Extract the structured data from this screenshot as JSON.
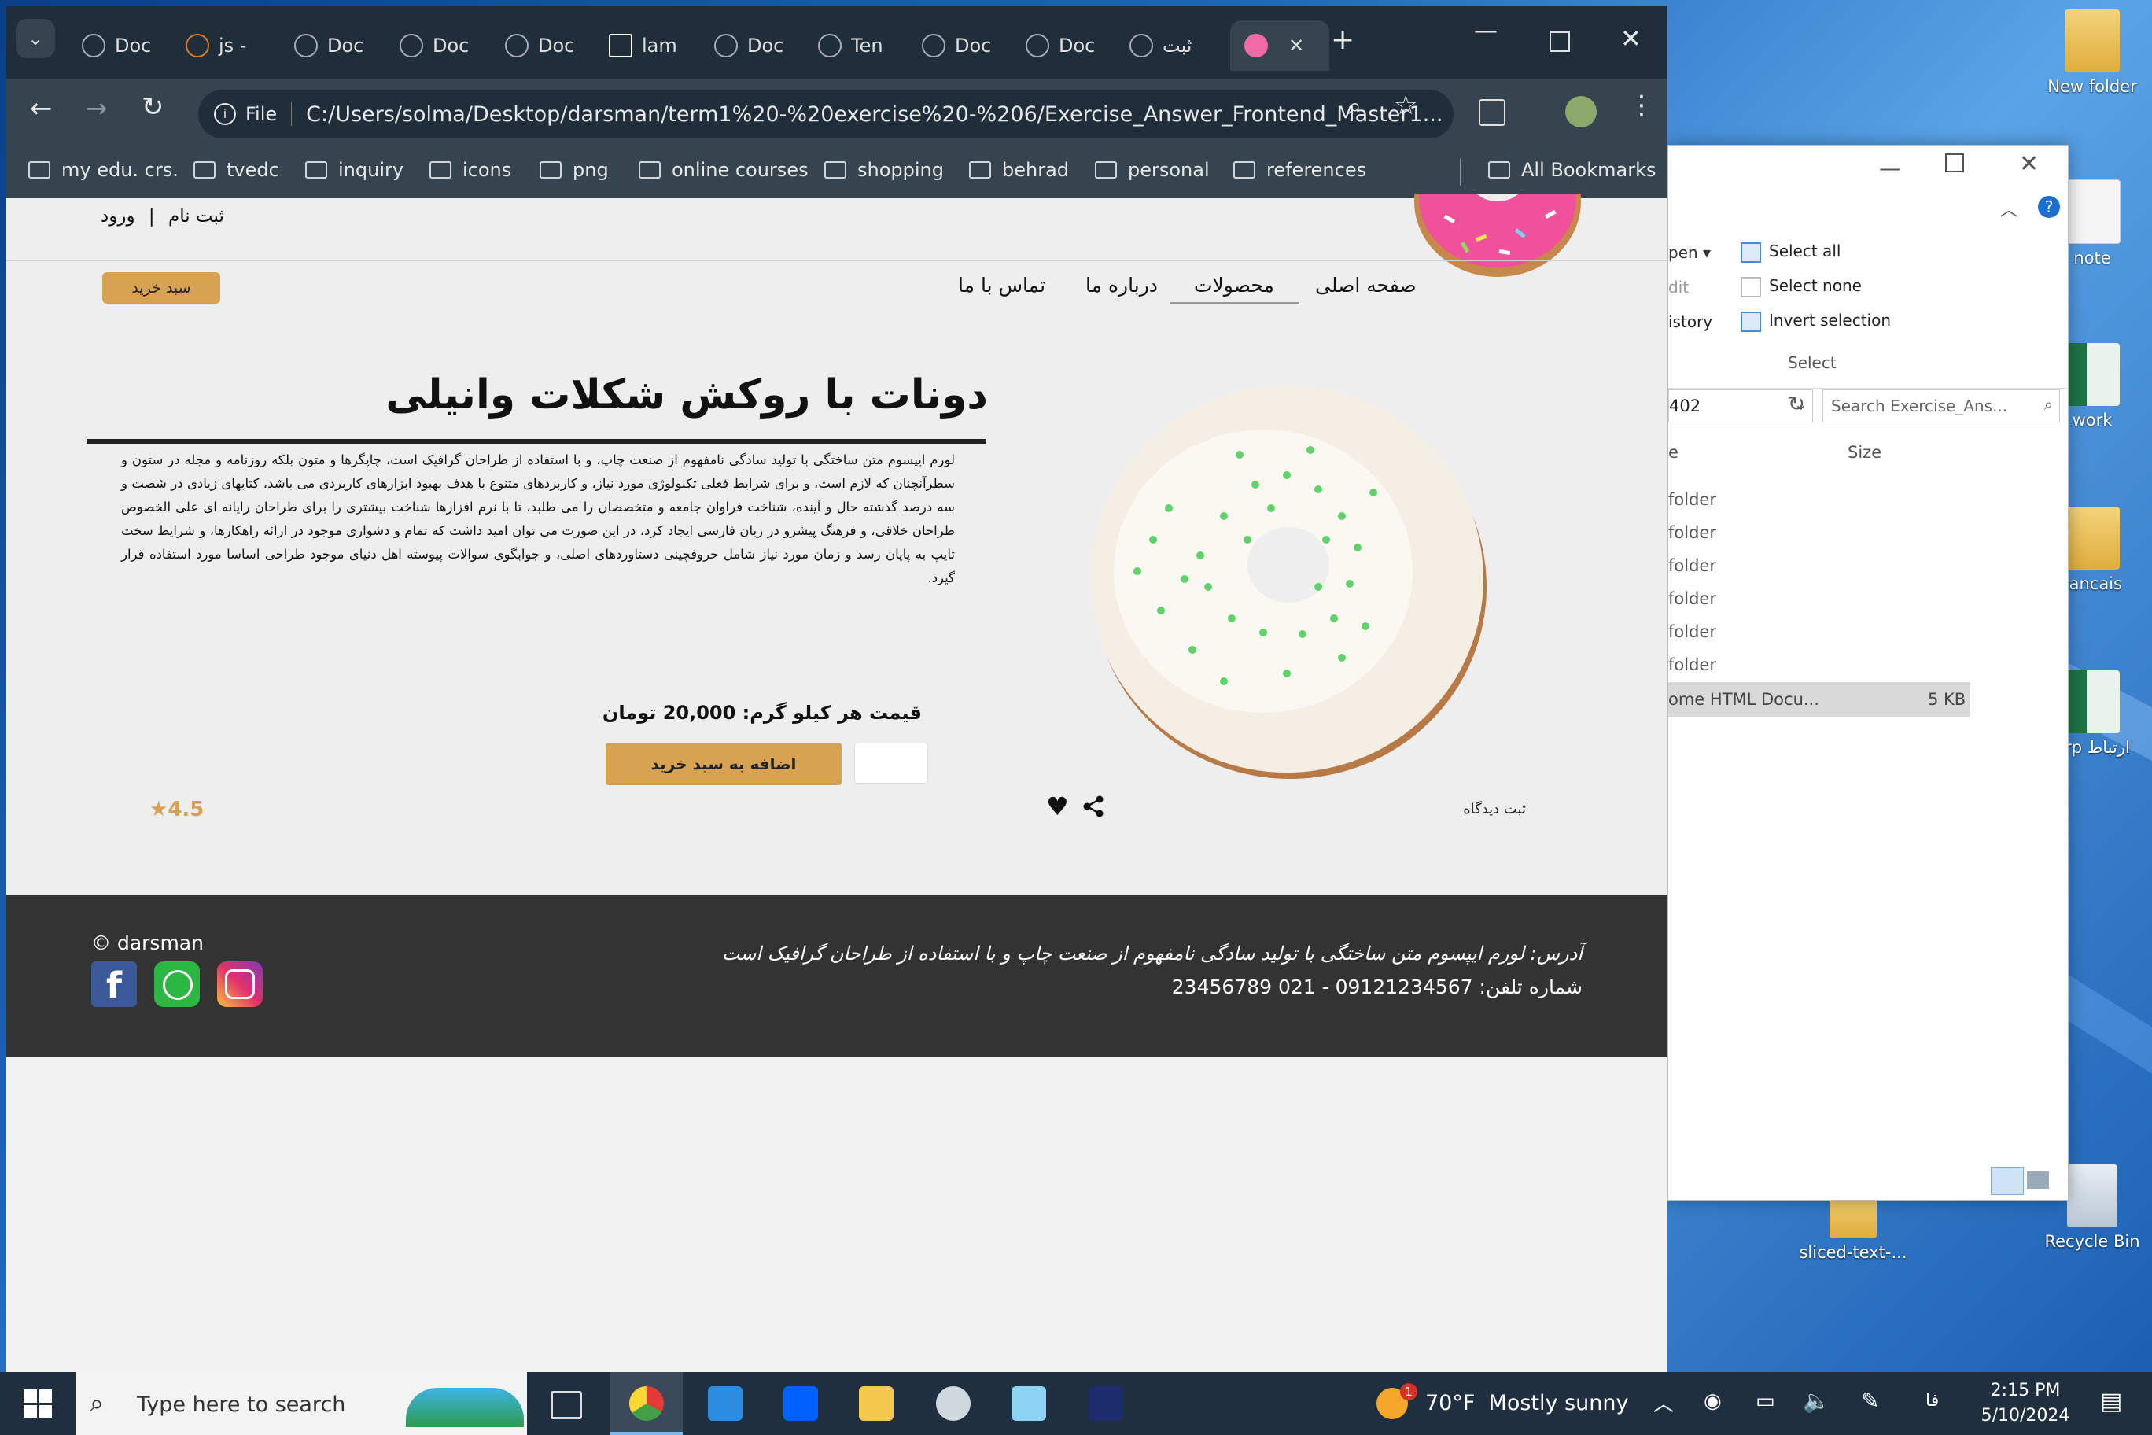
{
  "browser": {
    "tabs": [
      {
        "label": "Doc",
        "active": false
      },
      {
        "label": "js -",
        "active": false
      },
      {
        "label": "Doc",
        "active": false
      },
      {
        "label": "Doc",
        "active": false
      },
      {
        "label": "Doc",
        "active": false
      },
      {
        "label": "lam",
        "active": false
      },
      {
        "label": "Doc",
        "active": false
      },
      {
        "label": "Ten",
        "active": false
      },
      {
        "label": "Doc",
        "active": false
      },
      {
        "label": "Doc",
        "active": false
      },
      {
        "label": "ثبت",
        "active": false
      },
      {
        "label": "",
        "active": true
      }
    ],
    "url_scheme": "File",
    "url": "C:/Users/solma/Desktop/darsman/term1%20-%20exercise%20-%206/Exercise_Answer_Frontend_Master1...",
    "bookmarks": [
      "my edu. crs.",
      "tvedc",
      "inquiry",
      "icons",
      "png",
      "online courses",
      "shopping",
      "behrad",
      "personal",
      "references"
    ],
    "all_bookmarks": "All Bookmarks"
  },
  "site": {
    "auth": {
      "register": "ثبت نام",
      "separator": "|",
      "login": "ورود"
    },
    "cart_button": "سبد خرید",
    "nav": {
      "home": "صفحه اصلی",
      "products": "محصولات",
      "about": "درباره ما",
      "contact": "تماس با ما"
    },
    "product": {
      "title": "دونات با روکش شکلات وانیلی",
      "description": "لورم ایپسوم متن ساختگی با تولید سادگی نامفهوم از صنعت چاپ، و با استفاده از طراحان گرافیک است، چاپگرها و متون بلکه روزنامه و مجله در ستون و سطرآنچنان که لازم است، و برای شرایط فعلی تکنولوژی مورد نیاز، و کاربردهای متنوع با هدف بهبود ابزارهای کاربردی می باشد، کتابهای زیادی در شصت و سه درصد گذشته حال و آینده، شناخت فراوان جامعه و متخصصان را می طلبد، تا با نرم افزارها شناخت بیشتری را برای طراحان رایانه ای علی الخصوص طراحان خلاقی، و فرهنگ پیشرو در زبان فارسی ایجاد کرد، در این صورت می توان امید داشت که تمام و دشواری موجود در ارائه راهکارها، و شرایط سخت تایپ به پایان رسد و زمان مورد نیاز شامل حروفچینی دستاوردهای اصلی، و جوابگوی سوالات پیوسته اهل دنیای موجود طراحی اساسا مورد استفاده قرار گیرد.",
      "price": "قیمت هر کیلو گرم: 20,000 تومان",
      "add_to_cart": "اضافه به سبد خرید",
      "rating": "4.5",
      "comment_link": "ثبت دیدگاه"
    },
    "footer": {
      "copyright": "© darsman",
      "address": "آدرس: لورم ایپسوم متن ساختگی با تولید سادگی نامفهوم از صنعت چاپ و با استفاده از طراحان گرافیک است",
      "phone": "شماره تلفن: 09121234567 - 021 23456789"
    }
  },
  "explorer": {
    "commands": [
      "Select all",
      "Select none",
      "Invert selection"
    ],
    "group_label": "Select",
    "left_cmds": [
      "pen",
      "dit",
      "istory"
    ],
    "path_fragment": "402",
    "search_placeholder": "Search Exercise_Ans...",
    "col_size": "Size",
    "col_name_frag": "e",
    "rows": [
      "folder",
      "folder",
      "folder",
      "folder",
      "folder",
      "folder"
    ],
    "file_row": {
      "name": "ome HTML Docu...",
      "size": "5 KB"
    }
  },
  "desktop": {
    "icons": [
      "New folder",
      "note",
      "work",
      "rancais",
      "erp ارتباط",
      "sliced-text-...",
      "Recycle Bin"
    ]
  },
  "taskbar": {
    "search_placeholder": "Type here to search",
    "weather": "70°F  Mostly sunny",
    "time": "2:15 PM",
    "date": "5/10/2024",
    "lang": "فا",
    "notification_count": "1"
  }
}
